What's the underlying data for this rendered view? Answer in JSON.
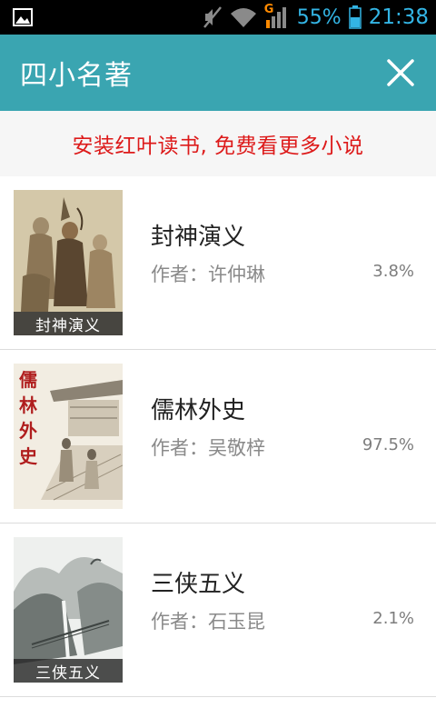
{
  "status_bar": {
    "battery": "55%",
    "time": "21:38",
    "network_label": "G",
    "icons": [
      "gallery-icon",
      "mute-icon",
      "wifi-icon",
      "signal-icon",
      "battery-icon"
    ]
  },
  "header": {
    "title": "四小名著",
    "close_icon": "close-icon",
    "color": "#3aa5b1"
  },
  "banner": {
    "text": "安装红叶读书, 免费看更多小说",
    "color": "#dd1a1a"
  },
  "books": [
    {
      "title": "封神演义",
      "author": "作者：许仲琳",
      "progress": "3.8%",
      "cover_label": "封神演义"
    },
    {
      "title": "儒林外史",
      "author": "作者：吴敬梓",
      "progress": "97.5%",
      "cover_vertical_text": "儒林外史"
    },
    {
      "title": "三侠五义",
      "author": "作者：石玉昆",
      "progress": "2.1%",
      "cover_label": "三侠五义"
    }
  ]
}
